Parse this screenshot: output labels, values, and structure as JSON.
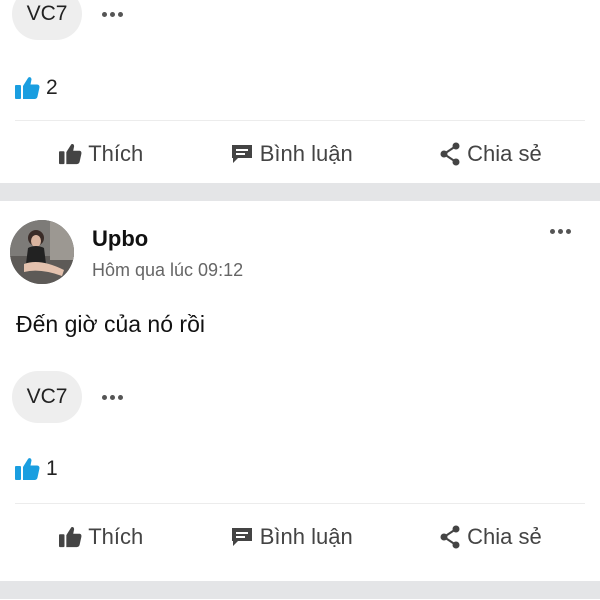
{
  "post1": {
    "tag": "VC7",
    "reaction_count": "2",
    "actions": {
      "like": "Thích",
      "comment": "Bình luận",
      "share": "Chia sẻ"
    }
  },
  "post2": {
    "author": "Upbo",
    "time": "Hôm qua lúc 09:12",
    "text": "Đến giờ của nó rồi",
    "tag": "VC7",
    "reaction_count": "1",
    "actions": {
      "like": "Thích",
      "comment": "Bình luận",
      "share": "Chia sẻ"
    }
  },
  "icons": {
    "like_reaction": "thumbs-up-icon",
    "like_action": "thumbs-up-outline-icon",
    "comment_action": "comment-icon",
    "share_action": "share-icon",
    "more": "more-horizontal-icon"
  },
  "colors": {
    "accent": "#1a9ee0",
    "separator": "#e4e5e7"
  }
}
